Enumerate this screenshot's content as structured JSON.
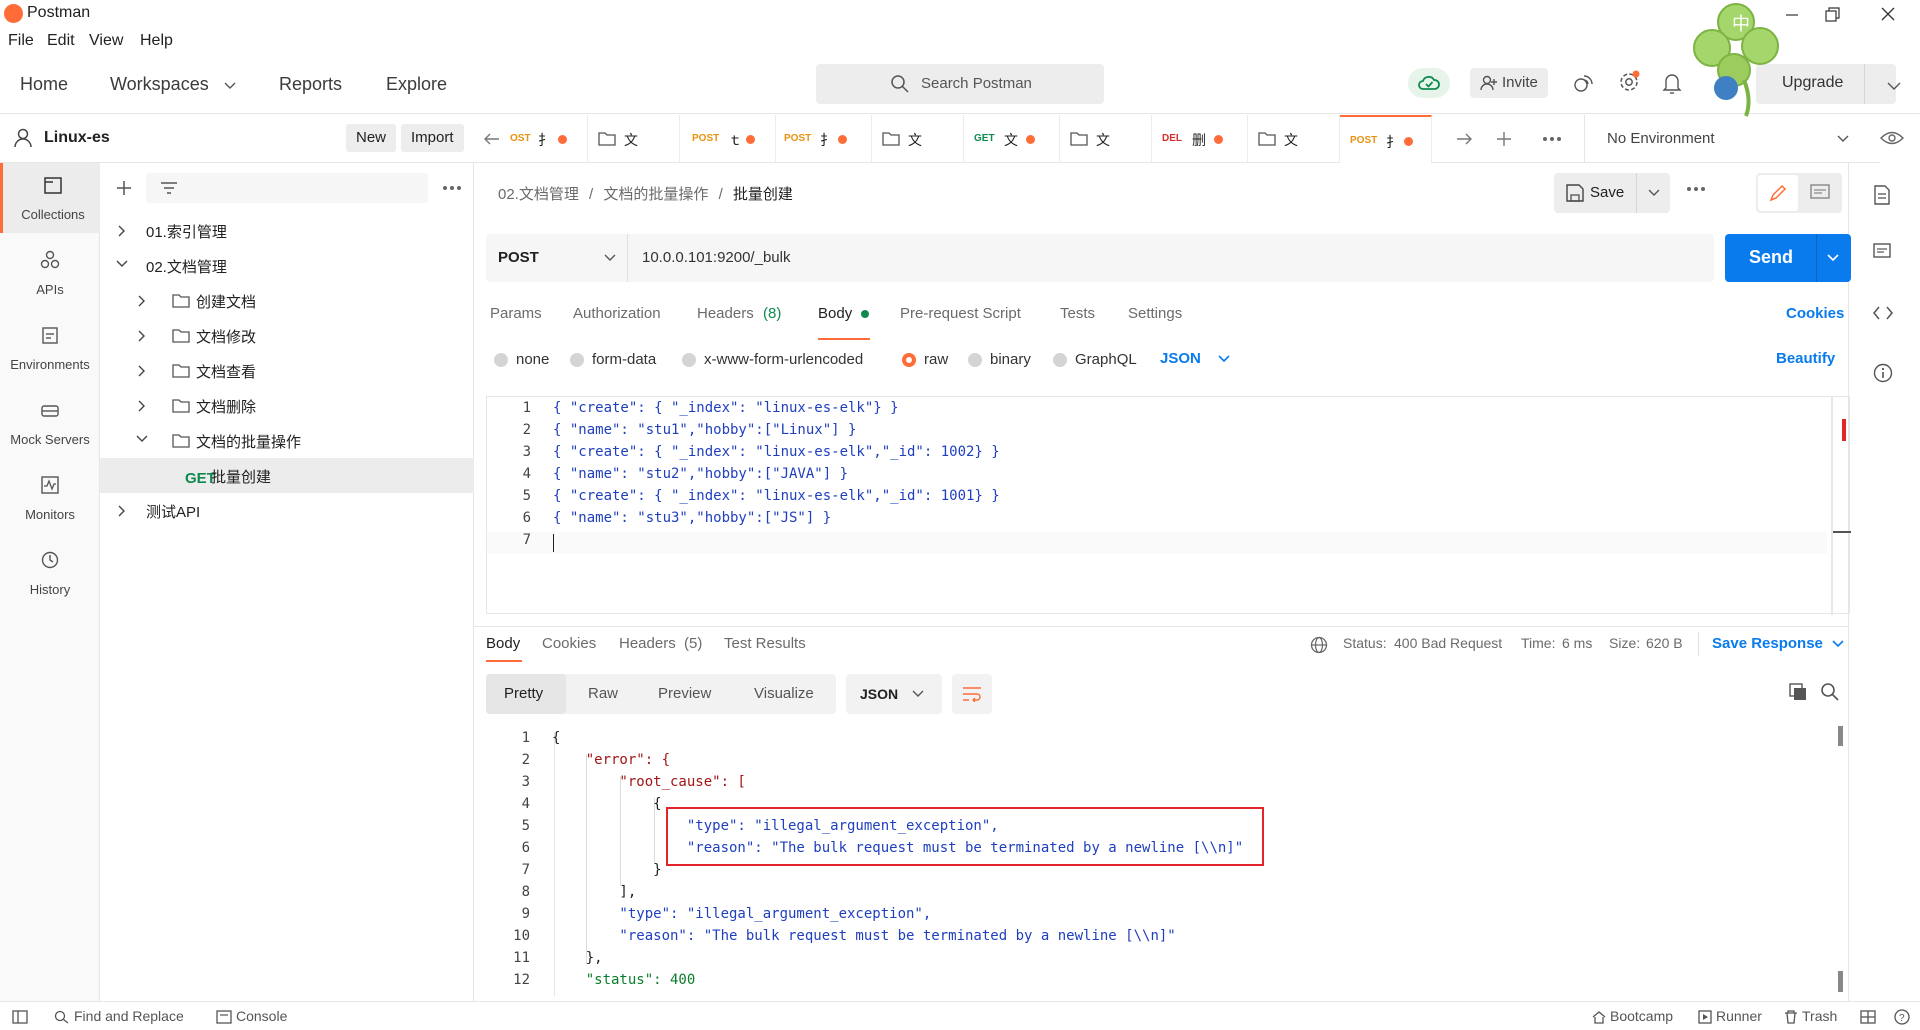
{
  "app": {
    "title": "Postman"
  },
  "menu": [
    "File",
    "Edit",
    "View",
    "Help"
  ],
  "header": {
    "nav": [
      "Home",
      "Workspaces",
      "Reports",
      "Explore"
    ],
    "search_placeholder": "Search Postman",
    "invite_label": "Invite",
    "upgrade_label": "Upgrade"
  },
  "workspace": {
    "name": "Linux-es",
    "new_label": "New",
    "import_label": "Import"
  },
  "rail": [
    "Collections",
    "APIs",
    "Environments",
    "Mock Servers",
    "Monitors",
    "History"
  ],
  "tree": [
    {
      "label": "01.索引管理"
    },
    {
      "label": "02.文档管理"
    },
    {
      "label": "创建文档"
    },
    {
      "label": "文档修改"
    },
    {
      "label": "文档查看"
    },
    {
      "label": "文档删除"
    },
    {
      "label": "文档的批量操作"
    },
    {
      "method": "GET",
      "label": "批量创建"
    },
    {
      "label": "测试API"
    }
  ],
  "tabs": [
    {
      "method": "OST",
      "name": "扌"
    },
    {
      "name": "文"
    },
    {
      "method": "POST",
      "name": "ｔ"
    },
    {
      "method": "POST",
      "name": "扌"
    },
    {
      "name": "文"
    },
    {
      "method": "GET",
      "name": "文"
    },
    {
      "name": "文"
    },
    {
      "method": "DEL",
      "name": "删"
    },
    {
      "name": "文"
    },
    {
      "method": "POST",
      "name": "扌"
    }
  ],
  "environment": {
    "selected": "No Environment"
  },
  "request": {
    "breadcrumb": [
      "02.文档管理",
      "文档的批量操作",
      "批量创建"
    ],
    "save_label": "Save",
    "method": "POST",
    "url": "10.0.0.101:9200/_bulk",
    "send_label": "Send",
    "tabs": [
      "Params",
      "Authorization",
      "Headers",
      "(8)",
      "Body",
      "Pre-request Script",
      "Tests",
      "Settings"
    ],
    "cookies_label": "Cookies",
    "body_types": [
      "none",
      "form-data",
      "x-www-form-urlencoded",
      "raw",
      "binary",
      "GraphQL"
    ],
    "body_format": "JSON",
    "beautify_label": "Beautify",
    "body_lines": [
      "{ \"create\": { \"_index\": \"linux-es-elk\"} }",
      "{ \"name\": \"stu1\",\"hobby\":[\"Linux\"] }",
      "{ \"create\": { \"_index\": \"linux-es-elk\",\"_id\": 1002} }",
      "{ \"name\": \"stu2\",\"hobby\":[\"JAVA\"] }",
      "{ \"create\": { \"_index\": \"linux-es-elk\",\"_id\": 1001} }",
      "{ \"name\": \"stu3\",\"hobby\":[\"JS\"] }",
      ""
    ]
  },
  "response": {
    "tabs": [
      "Body",
      "Cookies",
      "Headers",
      "(5)",
      "Test Results"
    ],
    "status_label": "Status:",
    "status_value": "400 Bad Request",
    "time_label": "Time:",
    "time_value": "6 ms",
    "size_label": "Size:",
    "size_value": "620 B",
    "save_response_label": "Save Response",
    "views": [
      "Pretty",
      "Raw",
      "Preview",
      "Visualize"
    ],
    "format": "JSON",
    "body_lines": [
      "{",
      "    \"error\": {",
      "        \"root_cause\": [",
      "            {",
      "                \"type\": \"illegal_argument_exception\",",
      "                \"reason\": \"The bulk request must be terminated by a newline [\\\\n]\"",
      "            }",
      "        ],",
      "        \"type\": \"illegal_argument_exception\",",
      "        \"reason\": \"The bulk request must be terminated by a newline [\\\\n]\"",
      "    },",
      "    \"status\": 400"
    ]
  },
  "footer": {
    "find_replace": "Find and Replace",
    "console": "Console",
    "bootcamp": "Bootcamp",
    "runner": "Runner",
    "trash": "Trash"
  },
  "colors": {
    "accent": "#ff6c37",
    "send": "#097bed",
    "status_ok_green": "#0f8a4f",
    "highlight": "#e3242b"
  }
}
